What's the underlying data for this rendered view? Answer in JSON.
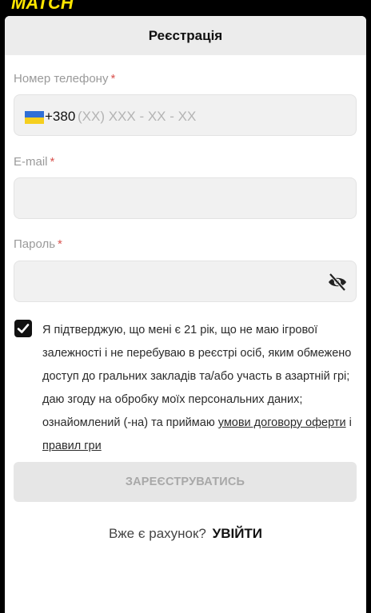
{
  "brand": {
    "logo_text": "MATCH",
    "accent": "#ffe600"
  },
  "header": {
    "title": "Реєстрація"
  },
  "form": {
    "phone": {
      "label": "Номер телефону",
      "required_mark": "*",
      "country_flag": "ukraine-flag",
      "prefix": "+380",
      "placeholder": "(XX) XXX - XX - XX",
      "value": ""
    },
    "email": {
      "label": "E-mail",
      "required_mark": "*",
      "value": ""
    },
    "password": {
      "label": "Пароль",
      "required_mark": "*",
      "value": "",
      "toggle_icon": "eye-slash-icon"
    },
    "consent": {
      "checked": true,
      "text": "Я підтверджую, що мені є 21 рік, що не маю ігрової залежності і не перебуваю в реєстрі осіб, яким обмежено доступ до гральних закладів та/або участь в азартній грі; даю згоду на обробку моїх персональних даних; ознайомлений (-на) та приймаю",
      "link_terms": "умови договору оферти",
      "conjunction": "і",
      "link_rules": "правил гри"
    },
    "submit_label": "ЗАРЕЄСТРУВАТИСЬ"
  },
  "footer": {
    "have_account": "Вже є рахунок?",
    "login_label": "УВІЙТИ"
  }
}
